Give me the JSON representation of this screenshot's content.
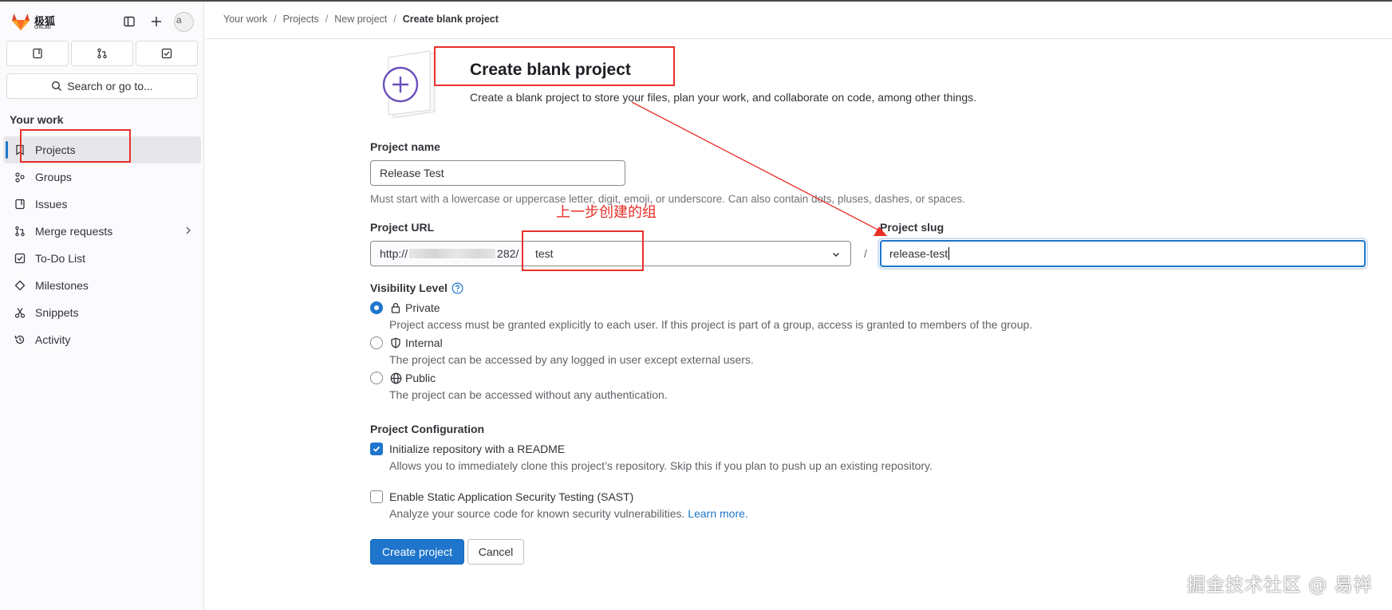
{
  "brand": {
    "name": "极狐",
    "sub": "GitLab"
  },
  "avatar": {
    "alt": "a"
  },
  "sidebar": {
    "search_label": "Search or go to...",
    "section_title": "Your work",
    "items": [
      {
        "label": "Projects",
        "icon": "project-icon",
        "active": true
      },
      {
        "label": "Groups",
        "icon": "group-icon"
      },
      {
        "label": "Issues",
        "icon": "issues-icon"
      },
      {
        "label": "Merge requests",
        "icon": "merge-request-icon",
        "has_chevron": true
      },
      {
        "label": "To-Do List",
        "icon": "todo-icon"
      },
      {
        "label": "Milestones",
        "icon": "milestone-icon"
      },
      {
        "label": "Snippets",
        "icon": "snippet-icon"
      },
      {
        "label": "Activity",
        "icon": "history-icon"
      }
    ]
  },
  "breadcrumb": [
    "Your work",
    "Projects",
    "New project",
    "Create blank project"
  ],
  "page": {
    "title": "Create blank project",
    "description": "Create a blank project to store your files, plan your work, and collaborate on code, among other things."
  },
  "form": {
    "project_name_label": "Project name",
    "project_name_value": "Release Test",
    "project_name_help": "Must start with a lowercase or uppercase letter, digit, emoji, or underscore. Can also contain dots, pluses, dashes, or spaces.",
    "project_url_label": "Project URL",
    "url_prefix_start": "http://",
    "url_prefix_end": "282/",
    "namespace_value": "test",
    "slash": "/",
    "project_slug_label": "Project slug",
    "project_slug_value": "release-test",
    "visibility_label": "Visibility Level",
    "visibility_options": [
      {
        "label": "Private",
        "desc": "Project access must be granted explicitly to each user. If this project is part of a group, access is granted to members of the group.",
        "checked": true
      },
      {
        "label": "Internal",
        "desc": "The project can be accessed by any logged in user except external users.",
        "checked": false
      },
      {
        "label": "Public",
        "desc": "The project can be accessed without any authentication.",
        "checked": false
      }
    ],
    "config_label": "Project Configuration",
    "readme": {
      "label": "Initialize repository with a README",
      "desc": "Allows you to immediately clone this project’s repository. Skip this if you plan to push up an existing repository.",
      "checked": true
    },
    "sast": {
      "label": "Enable Static Application Security Testing (SAST)",
      "desc": "Analyze your source code for known security vulnerabilities.",
      "link": "Learn more.",
      "checked": false
    },
    "create_button": "Create project",
    "cancel_button": "Cancel"
  },
  "annotation": {
    "text": "上一步创建的组",
    "color": "#e8302a"
  },
  "watermark": "掘金技术社区 @ 易祥",
  "colors": {
    "primary": "#1f75cb",
    "annotation": "#e8302a",
    "sidebar_bg": "#fbfafd"
  }
}
